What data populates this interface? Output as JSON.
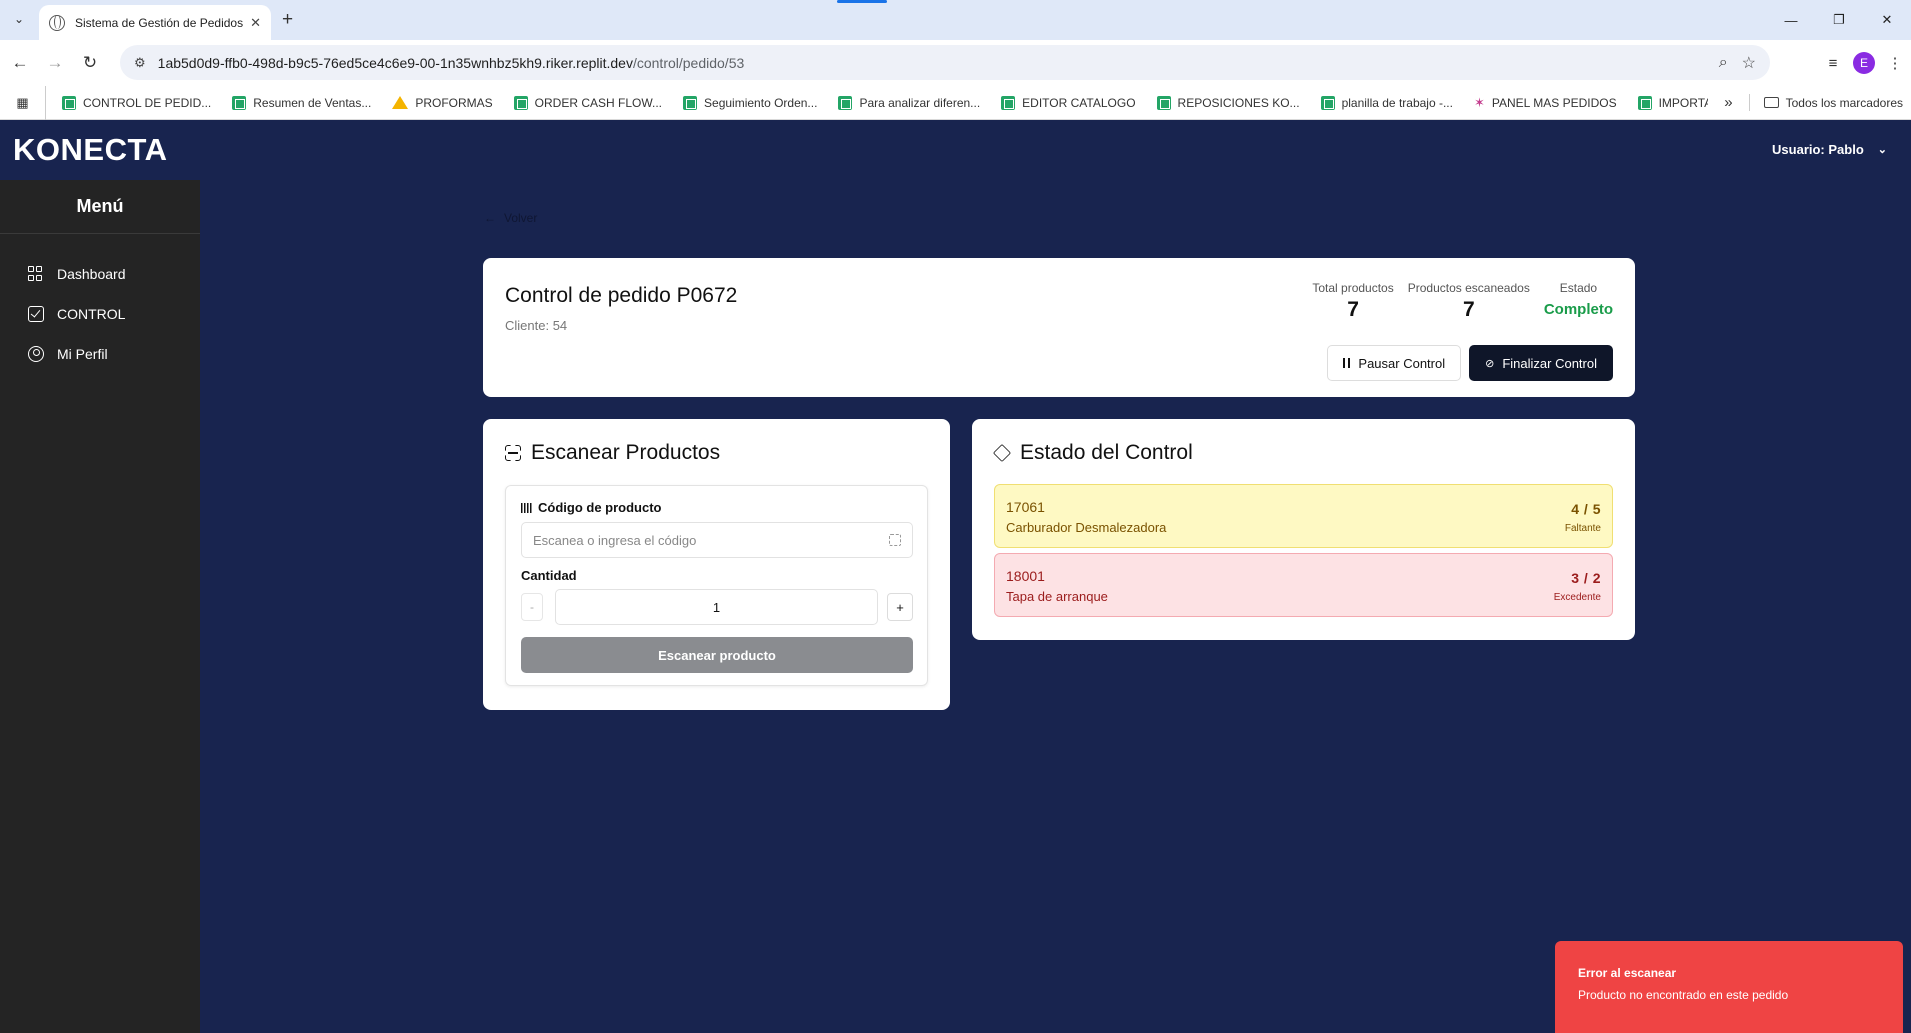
{
  "browser": {
    "tab_title": "Sistema de Gestión de Pedidos",
    "tab_close": "✕",
    "new_tab": "+",
    "url_host": "1ab5d0d9-ffb0-498d-b9c5-76ed5ce4c6e9-00-1n35wnhbz5kh9.riker.replit.dev",
    "url_path": "/control/pedido/53",
    "profile_initial": "E",
    "bookmarks": [
      {
        "label": "CONTROL DE PEDID...",
        "icon": "sheet"
      },
      {
        "label": "Resumen de Ventas...",
        "icon": "sheet"
      },
      {
        "label": "PROFORMAS",
        "icon": "drive"
      },
      {
        "label": "ORDER CASH FLOW...",
        "icon": "sheet"
      },
      {
        "label": "Seguimiento Orden...",
        "icon": "sheet"
      },
      {
        "label": "Para analizar diferen...",
        "icon": "sheet"
      },
      {
        "label": "EDITOR CATALOGO",
        "icon": "sheet"
      },
      {
        "label": "REPOSICIONES KO...",
        "icon": "sheet"
      },
      {
        "label": "planilla de trabajo -...",
        "icon": "sheet"
      },
      {
        "label": "PANEL MAS PEDIDOS",
        "icon": "star-b"
      },
      {
        "label": "IMPORTACIONES K...",
        "icon": "sheet"
      }
    ],
    "bookmarks_more": "»",
    "all_bookmarks": "Todos los marcadores"
  },
  "app": {
    "brand": "KONECTA",
    "user_label": "Usuario: Pablo"
  },
  "sidebar": {
    "title": "Menú",
    "items": [
      {
        "label": "Dashboard",
        "icon": "grid-icon"
      },
      {
        "label": "CONTROL",
        "icon": "check-square-icon"
      },
      {
        "label": "Mi Perfil",
        "icon": "user-circle-icon"
      }
    ]
  },
  "main": {
    "back_label": "Volver",
    "order_title": "Control de pedido P0672",
    "client_line": "Cliente: 54",
    "stats": {
      "total_label": "Total productos",
      "total_value": "7",
      "scanned_label": "Productos escaneados",
      "scanned_value": "7",
      "state_label": "Estado",
      "state_value": "Completo"
    },
    "pause_label": "Pausar Control",
    "finish_label": "Finalizar Control",
    "scan": {
      "heading": "Escanear Productos",
      "code_label": "Código de producto",
      "code_placeholder": "Escanea o ingresa el código",
      "qty_label": "Cantidad",
      "qty_minus": "-",
      "qty_value": "1",
      "qty_plus": "+",
      "submit_label": "Escanear producto"
    },
    "status": {
      "heading": "Estado del Control",
      "rows": [
        {
          "code": "17061",
          "name": "Carburador Desmalezadora",
          "count": "4 / 5",
          "state": "Faltante"
        },
        {
          "code": "18001",
          "name": "Tapa de arranque",
          "count": "3 / 2",
          "state": "Excedente"
        }
      ]
    }
  },
  "toast": {
    "title": "Error al escanear",
    "message": "Producto no encontrado en este pedido"
  },
  "colors": {
    "app_bg": "#18244f",
    "sidebar_bg": "#242424",
    "success": "#1a9c4a",
    "missing_bg": "#fef9c3",
    "excess_bg": "#fde2e4",
    "toast_bg": "#ef4444"
  }
}
